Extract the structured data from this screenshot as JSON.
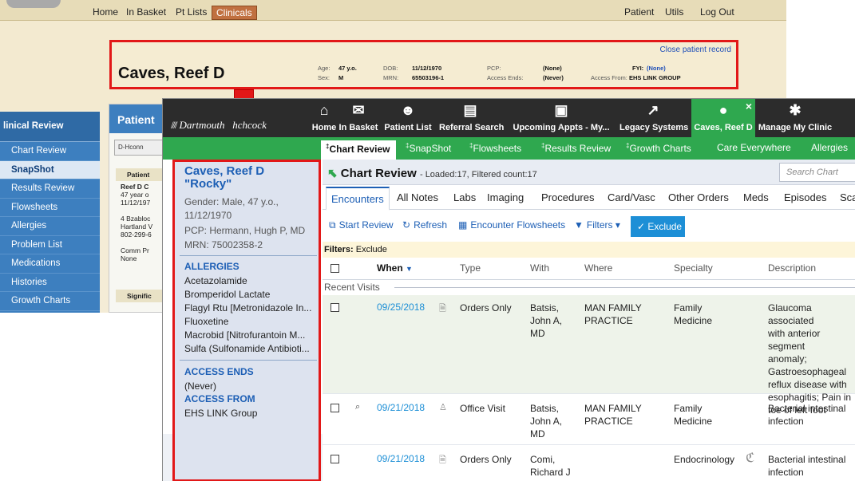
{
  "old_app": {
    "nav": [
      "Home",
      "In Basket",
      "Pt Lists",
      "Clinicals"
    ],
    "nav_right": [
      "Patient",
      "Utils",
      "Log Out"
    ],
    "patient": {
      "name": "Caves, Reef D",
      "close_link": "Close patient record",
      "age_label": "Age:",
      "age": "47 y.o.",
      "sex_label": "Sex:",
      "sex": "M",
      "dob_label": "DOB:",
      "dob": "11/12/1970",
      "mrn_label": "MRN:",
      "mrn": "65503196-1",
      "pcp_label": "PCP:",
      "pcp": "(None)",
      "access_ends_label": "Access Ends:",
      "access_ends": "(Never)",
      "fyi_label": "FYI:",
      "fyi": "(None)",
      "access_from_label": "Access From:",
      "access_from": "EHS LINK GROUP"
    },
    "sidebar_header": "linical Review",
    "sidebar": [
      "Chart Review",
      "SnapShot",
      "Results Review",
      "Flowsheets",
      "Allergies",
      "Problem List",
      "Medications",
      "Histories",
      "Growth Charts"
    ],
    "sidebar_selected": "SnapShot",
    "panel": {
      "title": "Patient",
      "tab": "D-Hconn",
      "section1": "Patient",
      "lines": [
        "Reef D C",
        "47 year o",
        "11/12/197",
        "",
        "4 Bzabloc",
        "Hartland V",
        "802-299-6",
        "",
        "Comm Pr",
        "None"
      ],
      "section2": "Signific"
    }
  },
  "new_app": {
    "brand_prefix": "Dartmouth",
    "brand_suffix": "hchcock",
    "toolbar": [
      {
        "icon": "home-icon",
        "glyph": "⌂",
        "label": "Home"
      },
      {
        "icon": "mail-icon",
        "glyph": "✉",
        "label": "In Basket"
      },
      {
        "icon": "patients-icon",
        "glyph": "☻",
        "label": "Patient List"
      },
      {
        "icon": "referral-icon",
        "glyph": "▤",
        "label": "Referral Search"
      },
      {
        "icon": "calendar-icon",
        "glyph": "▣",
        "label": "Upcoming Appts - My..."
      },
      {
        "icon": "external-link-icon",
        "glyph": "↗",
        "label": "Legacy Systems"
      },
      {
        "icon": "patient-icon",
        "glyph": "●",
        "label": "Caves, Reef D"
      },
      {
        "icon": "gear-icon",
        "glyph": "✱",
        "label": "Manage My Clinic"
      }
    ],
    "tabs": [
      "Chart Review",
      "SnapShot",
      "Flowsheets",
      "Results Review",
      "Growth Charts",
      "Care Everywhere",
      "Allergies"
    ],
    "patient": {
      "name_line1": "Caves, Reef D",
      "name_line2": "\"Rocky\"",
      "gender": "Gender: Male, 47 y.o.,",
      "dob": "11/12/1970",
      "pcp": "PCP: Hermann, Hugh P, MD",
      "mrn": "MRN: 75002358-2",
      "allergies_label": "ALLERGIES",
      "allergies": [
        "Acetazolamide",
        "Bromperidol Lactate",
        "Flagyl Rtu [Metronidazole In...",
        "Fluoxetine",
        "Macrobid [Nitrofurantoin M...",
        "Sulfa (Sulfonamide Antibioti..."
      ],
      "access_ends_label": "ACCESS ENDS",
      "access_ends": "(Never)",
      "access_from_label": "ACCESS FROM",
      "access_from": "EHS LINK Group"
    },
    "chart_review": {
      "title": "Chart Review",
      "subtitle": "- Loaded:17, Filtered count:17",
      "search_placeholder": "Search Chart",
      "subtabs": [
        "Encounters",
        "All Notes",
        "Labs",
        "Imaging",
        "Procedures",
        "Card/Vasc",
        "Other Orders",
        "Meds",
        "Episodes",
        "Sca"
      ],
      "actions": {
        "start_review": "Start Review",
        "refresh": "Refresh",
        "encounter_flowsheets": "Encounter Flowsheets",
        "filters": "Filters",
        "exclude": "Exclude"
      },
      "filters_label": "Filters:",
      "filters_value": "Exclude",
      "columns": [
        "When",
        "Type",
        "With",
        "Where",
        "Specialty",
        "Description"
      ],
      "group_label": "Recent Visits",
      "rows": [
        {
          "when": "09/25/2018",
          "type": "Orders Only",
          "with": [
            "Batsis,",
            "John A,",
            "MD"
          ],
          "where": [
            "MAN FAMILY",
            "PRACTICE"
          ],
          "specialty": [
            "Family",
            "Medicine"
          ],
          "description": [
            "Glaucoma associated",
            "with anterior segment",
            "anomaly;",
            "Gastroesophageal",
            "reflux disease with",
            "esophagitis; Pain in",
            "toe of left foot"
          ]
        },
        {
          "when": "09/21/2018",
          "type": "Office Visit",
          "with": [
            "Batsis,",
            "John A,",
            "MD"
          ],
          "where": [
            "MAN FAMILY",
            "PRACTICE"
          ],
          "specialty": [
            "Family",
            "Medicine"
          ],
          "description": [
            "Bacterial intestinal",
            "infection"
          ]
        },
        {
          "when": "09/21/2018",
          "type": "Orders Only",
          "with": [
            "Comi,",
            "Richard J"
          ],
          "where": [
            ""
          ],
          "specialty": [
            "Endocrinology"
          ],
          "description": [
            "Bacterial intestinal",
            "infection"
          ]
        }
      ]
    }
  }
}
